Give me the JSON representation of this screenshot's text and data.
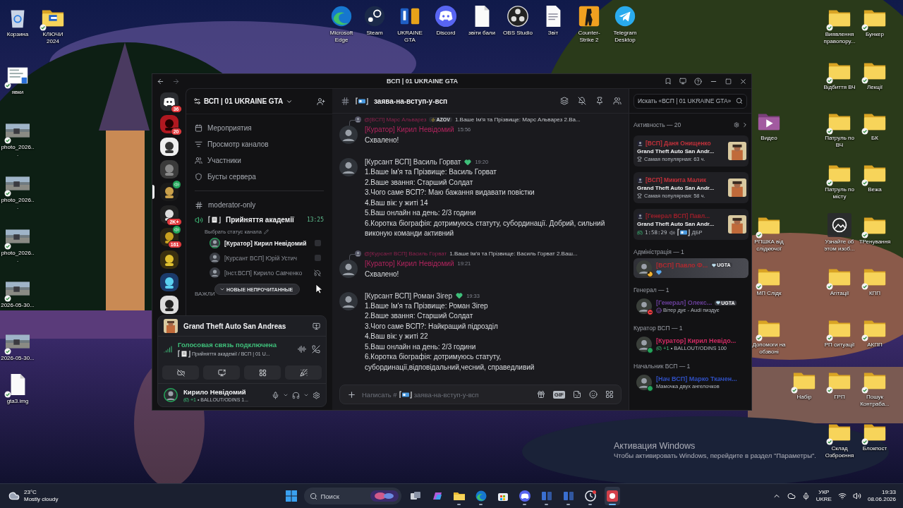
{
  "desktop": {
    "left_icons": [
      {
        "label": "Корзина",
        "kind": "recycle",
        "synced": false
      },
      {
        "label": "КЛЮЧИ 2024",
        "kind": "folder-doc",
        "synced": true
      },
      {
        "label": "явки",
        "kind": "doc-thumb",
        "synced": true
      },
      {
        "label": "photo_2026...",
        "synced": true
      },
      {
        "label": "photo_2026...",
        "synced": true
      },
      {
        "label": "photo_2026...",
        "synced": true
      },
      {
        "label": "2026-05-30...",
        "synced": true
      },
      {
        "label": "2026-05-30...",
        "synced": true
      },
      {
        "label": "gta3.img",
        "kind": "file",
        "synced": true
      }
    ],
    "top_icons": [
      {
        "label": "Microsoft Edge",
        "kind": "edge",
        "synced": false
      },
      {
        "label": "Steam",
        "kind": "steam",
        "synced": false
      },
      {
        "label": "UKRAINE GTA",
        "kind": "gta",
        "synced": false
      },
      {
        "label": "Discord",
        "kind": "discord",
        "synced": false
      },
      {
        "label": "звіти бали",
        "kind": "file",
        "synced": false
      },
      {
        "label": "OBS Studio",
        "kind": "obs",
        "synced": false
      },
      {
        "label": "Звіт",
        "kind": "doc",
        "synced": false
      },
      {
        "label": "Counter-Strike 2",
        "kind": "cs",
        "synced": false
      },
      {
        "label": "Telegram Desktop",
        "kind": "telegram",
        "synced": false
      }
    ],
    "right_icons": [
      {
        "label": "Виявлення правопору...",
        "kind": "folder",
        "synced": true
      },
      {
        "label": "Бункер",
        "kind": "folder",
        "synced": true
      },
      {
        "label": "Відбиття ВЧ",
        "kind": "folder",
        "synced": true
      },
      {
        "label": "Лекції",
        "kind": "folder",
        "synced": true
      },
      {
        "label": "Видео",
        "kind": "video-folder",
        "synced": false
      },
      {
        "label": "Патруль по ВЧ",
        "kind": "folder",
        "synced": true
      },
      {
        "label": "БК",
        "kind": "folder",
        "synced": true
      },
      {
        "label": "Патруль по місту",
        "kind": "folder",
        "synced": true
      },
      {
        "label": "Вежа",
        "kind": "folder",
        "synced": true
      },
      {
        "label": "РПШКА від слідкючої",
        "kind": "folder",
        "synced": true
      },
      {
        "label": "Узнайте об этом изоб...",
        "kind": "image-info",
        "synced": false
      },
      {
        "label": "ТРенування",
        "kind": "folder",
        "synced": true
      },
      {
        "label": "МП Слідк",
        "kind": "folder",
        "synced": true
      },
      {
        "label": "Агітації",
        "kind": "folder",
        "synced": true
      },
      {
        "label": "КПП",
        "kind": "folder",
        "synced": true
      },
      {
        "label": "Допомоги на обзвоні",
        "kind": "folder",
        "synced": true
      },
      {
        "label": "РП ситуації",
        "kind": "folder",
        "synced": true
      },
      {
        "label": "АКПП",
        "kind": "folder",
        "synced": true
      },
      {
        "label": "Набір",
        "kind": "folder",
        "synced": true
      },
      {
        "label": "ГРП",
        "kind": "folder",
        "synced": true
      },
      {
        "label": "Пошук Контраба...",
        "kind": "folder",
        "synced": true
      },
      {
        "label": "Склад Озброєння",
        "kind": "folder",
        "synced": true
      },
      {
        "label": "Блокпост",
        "kind": "folder",
        "synced": true
      }
    ],
    "activation_notice": {
      "title": "Активация Windows",
      "text": "Чтобы активировать Windows, перейдите в раздел \"Параметры\"."
    }
  },
  "window": {
    "title": "ВСП | 01 UKRAINE GTA"
  },
  "servers": [
    {
      "kind": "home",
      "badge": "36",
      "selected": false,
      "voice": false
    },
    {
      "kind": "server",
      "badge": "20",
      "selected": false,
      "voice": false
    },
    {
      "kind": "server",
      "selected": false,
      "voice": false
    },
    {
      "kind": "server",
      "selected": false,
      "voice": false
    },
    {
      "kind": "server",
      "selected": true,
      "voice": true
    },
    {
      "kind": "server",
      "badge": "2K+",
      "selected": false,
      "voice": false
    },
    {
      "kind": "server",
      "badge": "161",
      "selected": false,
      "voice": true
    },
    {
      "kind": "server",
      "selected": false,
      "voice": false
    },
    {
      "kind": "server",
      "selected": false,
      "voice": false
    },
    {
      "kind": "server",
      "selected": false,
      "voice": false
    }
  ],
  "sidebar": {
    "server_name": "ВСП | 01 UKRAINE GTA",
    "menu": [
      {
        "label": "Мероприятия",
        "kind": "events"
      },
      {
        "label": "Просмотр каналов",
        "kind": "browse"
      },
      {
        "label": "Участники",
        "kind": "members"
      },
      {
        "label": "Бусты сервера",
        "kind": "boosts"
      }
    ],
    "text_channel": "moderator-only",
    "voice_channel": {
      "name": "Прийняття академії",
      "time": "13:25",
      "status_hint": "Выбрать статус канала",
      "members": [
        {
          "name": "[Куратор] Кирил Невідомий",
          "speaking": true,
          "deafened": false
        },
        {
          "name": "[Курсант ВСП] Юрій Устич",
          "speaking": false,
          "deafened": false
        },
        {
          "name": "[Інст.ВСП] Кирило Савченко",
          "speaking": false,
          "deafened": true
        }
      ]
    },
    "category": "ВАЖЛИ",
    "unread_pill": "НОВЫЕ НЕПРОЧИТАННЫЕ"
  },
  "panel": {
    "activity": "Grand Theft Auto San Andreas",
    "voice_status": "Голосовая связь подключена",
    "voice_location": "Прийняття академії / ВСП | 01 U...",
    "user": {
      "name": "Кирило Невідомий",
      "count": "+1",
      "activity": "• BALLOUT/ODINS 1..."
    }
  },
  "chat": {
    "channel": "заява-на-вступ-у-всп",
    "search": {
      "placeholder": "Искать «ВСП | 01 UKRAINE GTA»"
    },
    "messages": [
      {
        "reply": {
          "author": "@[ВСП] Марс Альварез",
          "tag": "AZOV",
          "text": "1.Ваше Ім'я та Прізвище: Марс Альварез 2.Ва..."
        },
        "author": "[Куратор] Кирил Невідомий",
        "color": "#b3245e",
        "badge": false,
        "time": "15:56",
        "lines": [
          "Схвалено!"
        ]
      },
      {
        "author": "[Курсант ВСП] Василь Горват",
        "color": "#d4d6da",
        "badge": true,
        "time": "19:20",
        "lines": [
          "1.Ваше Ім'я та Прізвище: Василь Горват",
          "2.Ваше звання: Старший Солдат",
          "3.Чого саме ВСП?: Маю бажання видавати повістки",
          "4.Ваш вік: у житі 14",
          "5.Ваш онлайн на день:  2/3 години",
          "6.Коротка біографія: дотримуюсь статуту, субординації. Добрий, сильний виконую команди активний"
        ]
      },
      {
        "reply": {
          "author": "@[Курсант ВСП] Василь Горват",
          "text": "1.Ваше Ім'я та Прізвище: Василь Горват  2.Ваш..."
        },
        "author": "[Куратор] Кирил Невідомий",
        "color": "#b3245e",
        "badge": false,
        "time": "19:21",
        "lines": [
          "Схвалено!"
        ]
      },
      {
        "author": "[Курсант ВСП] Роман Зігер",
        "color": "#d4d6da",
        "badge": true,
        "time": "19:33",
        "lines": [
          "1.Ваше Ім'я та Прізвище: Роман Зігер",
          "2.Ваше звання: Старший Солдат",
          "3.Чого саме ВСП?: Найкращий підрозділ",
          "4.Ваш вік: у житі 22",
          "5.Ваш онлайн на день:  2/3 години",
          "6.Коротка біографія: дотримуюсь статуту, субординації,відповідальний,чесний, справедливий"
        ]
      }
    ],
    "composer": {
      "placeholder": "Написать #",
      "channel": "заява-на-вступ-у-всп",
      "gif_label": "GIF"
    }
  },
  "members": {
    "activity_header": "Активность — 20",
    "activities": [
      {
        "name": "[ВСП] Даня Онищенко",
        "color": "#c0303a",
        "game": "Grand Theft Auto San Andr...",
        "kind": "top",
        "detail": "Самая популярная: 63 ч."
      },
      {
        "name": "[ВСП] Микита Малик",
        "color": "#c0303a",
        "game": "Grand Theft Auto San Andr...",
        "kind": "top",
        "detail": "Самая популярная: 58 ч."
      },
      {
        "name": "[Генерал ВСП] Павл...",
        "color": "#9a1f2a",
        "game": "Grand Theft Auto San Andr...",
        "kind": "playing",
        "detail": "1:58:29",
        "channel": "ДБР"
      }
    ],
    "groups": [
      {
        "title": "Адміністрація — 1",
        "members": [
          {
            "name": "[ВСП] Павло Ф...",
            "color": "#b02a30",
            "tag": "UGTA",
            "idle": true,
            "dnd": false,
            "kind": "heart",
            "highlighted": true
          }
        ]
      },
      {
        "title": "Генерал — 1",
        "members": [
          {
            "name": "[Генерал] Олекс...",
            "color": "#6a3f9a",
            "tag": "UGTA",
            "idle": false,
            "dnd": true,
            "kind": "devil",
            "note": "Вітер дує - Audi пиздує",
            "highlighted": false
          }
        ]
      },
      {
        "title": "Куратор ВСП — 1",
        "members": [
          {
            "name": "[Куратор] Кирил Невідо...",
            "color": "#d12a62",
            "idle": false,
            "dnd": false,
            "kind": "game",
            "note_count": "+1",
            "note": "• BALLOUT/ODINS 100",
            "highlighted": false
          }
        ]
      },
      {
        "title": "Начальник ВСП — 1",
        "members": [
          {
            "name": "[Нач ВСП] Марко Ткачен...",
            "color": "#2f4fc0",
            "idle": false,
            "dnd": false,
            "kind": "plain",
            "note": "Мамочка двух ангелочков",
            "highlighted": false
          }
        ]
      }
    ]
  },
  "taskbar": {
    "weather": {
      "temp": "23°C",
      "text": "Mostly cloudy"
    },
    "search": {
      "placeholder": "Поиск"
    },
    "apps": [
      {
        "kind": "taskview",
        "open": false,
        "selected": false
      },
      {
        "kind": "copilot",
        "open": false,
        "selected": false
      },
      {
        "kind": "explorer",
        "open": true,
        "selected": false
      },
      {
        "kind": "edge",
        "open": true,
        "selected": false
      },
      {
        "kind": "store",
        "open": false,
        "selected": false
      },
      {
        "kind": "discord",
        "open": true,
        "selected": false
      },
      {
        "kind": "gta",
        "open": true,
        "selected": false
      },
      {
        "kind": "gta",
        "open": true,
        "selected": false
      },
      {
        "kind": "cs",
        "open": true,
        "selected": false
      },
      {
        "kind": "recorder",
        "open": true,
        "selected": true
      }
    ],
    "language": {
      "line1": "УКР",
      "line2": "UKRE"
    },
    "clock": {
      "time": "19:33",
      "date": "08.06.2026"
    }
  }
}
